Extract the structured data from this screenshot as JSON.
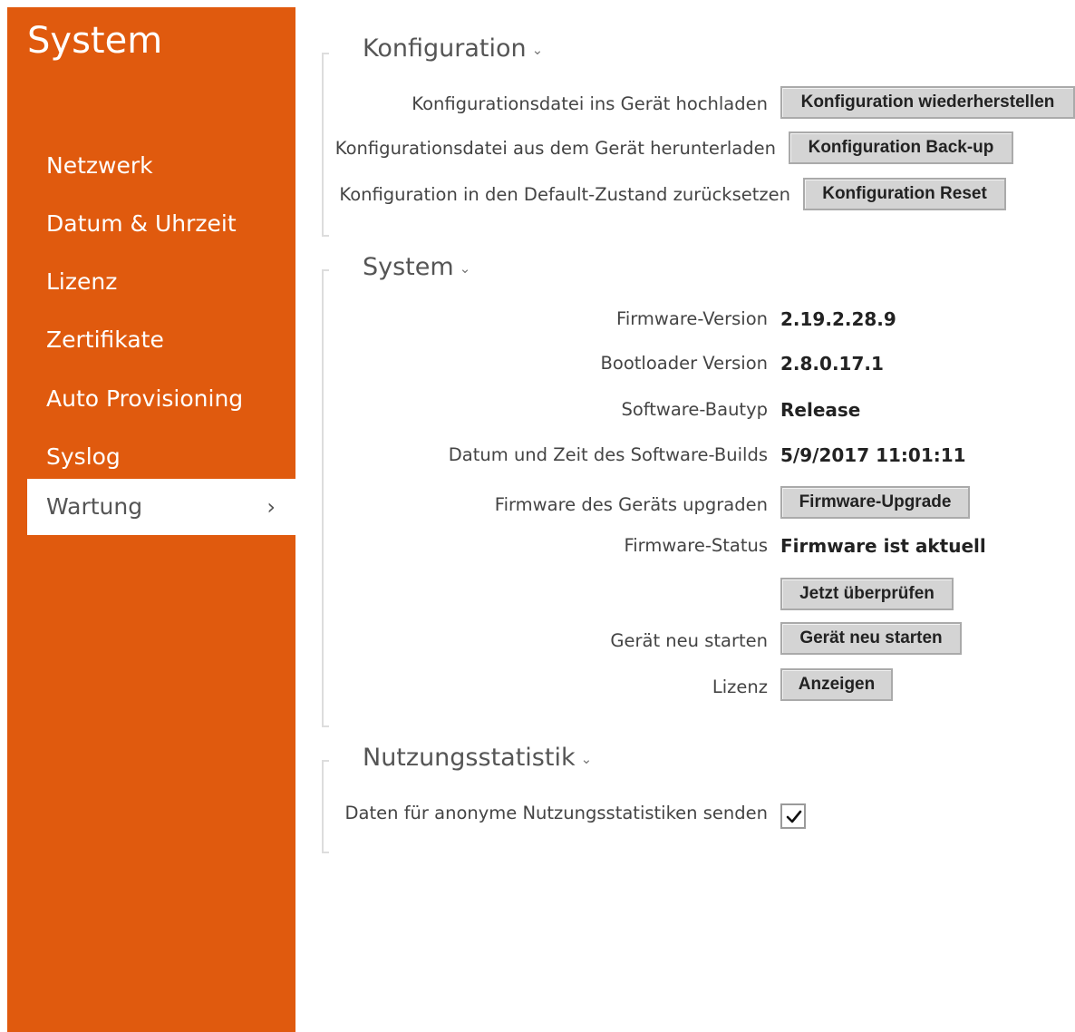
{
  "sidebar": {
    "title": "System",
    "items": [
      {
        "label": "Netzwerk"
      },
      {
        "label": "Datum & Uhrzeit"
      },
      {
        "label": "Lizenz"
      },
      {
        "label": "Zertifikate"
      },
      {
        "label": "Auto Provisioning"
      },
      {
        "label": "Syslog"
      },
      {
        "label": "Wartung",
        "active": true
      }
    ],
    "active_chevron": "›"
  },
  "konfiguration": {
    "title": "Konfiguration",
    "rows": [
      {
        "label": "Konfigurationsdatei ins Gerät hochladen",
        "button": "Konfiguration wiederherstellen"
      },
      {
        "label": "Konfigurationsdatei aus dem Gerät herunterladen",
        "button": "Konfiguration Back-up"
      },
      {
        "label": "Konfiguration in den Default-Zustand zurücksetzen",
        "button": "Konfiguration Reset"
      }
    ]
  },
  "system": {
    "title": "System",
    "firmware_version_label": "Firmware-Version",
    "firmware_version": "2.19.2.28.9",
    "bootloader_label": "Bootloader Version",
    "bootloader_version": "2.8.0.17.1",
    "build_type_label": "Software-Bautyp",
    "build_type": "Release",
    "build_date_label": "Datum und Zeit des Software-Builds",
    "build_date": "5/9/2017 11:01:11",
    "upgrade_label": "Firmware des Geräts upgraden",
    "upgrade_button": "Firmware-Upgrade",
    "status_label": "Firmware-Status",
    "status_value": "Firmware ist aktuell",
    "check_button": "Jetzt überprüfen",
    "restart_label": "Gerät neu starten",
    "restart_button": "Gerät neu starten",
    "license_label": "Lizenz",
    "license_button": "Anzeigen"
  },
  "statistik": {
    "title": "Nutzungsstatistik",
    "send_label": "Daten für anonyme Nutzungsstatistiken senden",
    "send_checked": true
  },
  "colors": {
    "sidebar_bg": "#e05a0e",
    "button_bg": "#d4d4d4"
  },
  "icons": {
    "caret": "chevron-down-icon",
    "nav_chevron": "chevron-right-icon",
    "check": "checkmark-icon"
  }
}
